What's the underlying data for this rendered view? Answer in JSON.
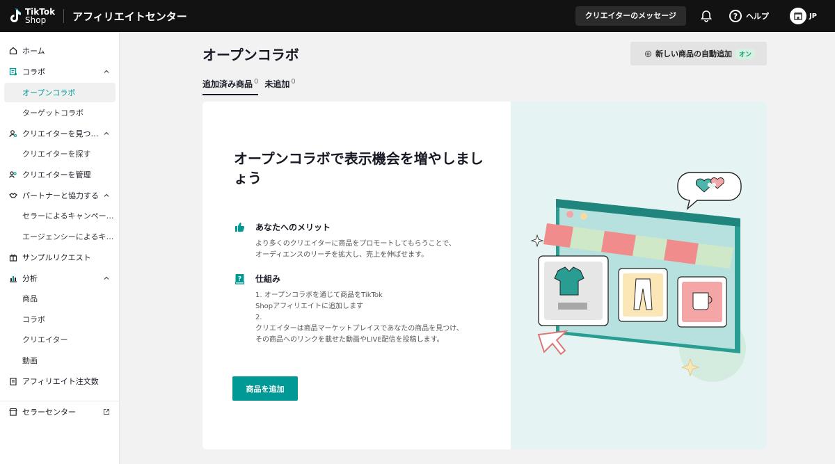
{
  "header": {
    "logo_line1": "TikTok",
    "logo_line2": "Shop",
    "app_title": "アフィリエイトセンター",
    "messages_label": "クリエイターのメッセージ",
    "help_label": "ヘルプ",
    "region_label": "JP"
  },
  "sidebar": {
    "home": "ホーム",
    "collab": "コラボ",
    "open_collab": "オープンコラボ",
    "target_collab": "ターゲットコラボ",
    "find_creators_group": "クリエイターを見つ…",
    "find_creators": "クリエイターを探す",
    "manage_creators": "クリエイターを管理",
    "partner_group": "パートナーと協力する",
    "seller_campaigns": "セラーによるキャンペー…",
    "agency": "エージェンシーによるキ…",
    "sample_requests": "サンプルリクエスト",
    "analytics": "分析",
    "analytics_products": "商品",
    "analytics_collab": "コラボ",
    "analytics_creators": "クリエイター",
    "analytics_videos": "動画",
    "affiliate_orders": "アフィリエイト注文数",
    "seller_center": "セラーセンター"
  },
  "main": {
    "title": "オープンコラボ",
    "auto_add_label": "新しい商品の自動追加",
    "auto_add_status": "オン",
    "tabs": [
      {
        "label": "追加済み商品",
        "count": "0"
      },
      {
        "label": "未追加",
        "count": "0"
      }
    ],
    "hero_title": "オープンコラボで表示機会を増やしましょう",
    "benefit_title": "あなたへのメリット",
    "benefit_body": "より多くのクリエイターに商品をプロモートしてもらうことで、\nオーディエンスのリーチを拡大し、売上を伸ばせます。",
    "how_title": "仕組み",
    "how_body": "1. オープンコラボを通じて商品をTikTok\nShopアフィリエイトに追加します\n2.\nクリエイターは商品マーケットプレイスであなたの商品を見つけ、\nその商品へのリンクを載せた動画やLIVE配信を投稿します。",
    "add_button": "商品を追加"
  },
  "colors": {
    "accent": "#009995",
    "topbar": "#121212",
    "illustration_bg": "#e5f4f2"
  }
}
